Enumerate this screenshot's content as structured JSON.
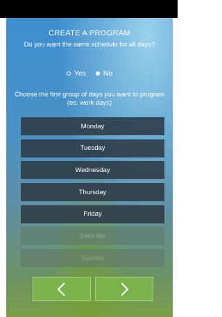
{
  "header": {
    "title": "CREATE A PROGRAM",
    "question": "Do you want the same schedule for all days?"
  },
  "schedule_choice": {
    "options": [
      {
        "label": "Yes",
        "selected": false
      },
      {
        "label": "No",
        "selected": true
      }
    ]
  },
  "instruction": "Choose the first group of days you want to program (es. work days)",
  "days": [
    {
      "label": "Monday",
      "enabled": true
    },
    {
      "label": "Tuesday",
      "enabled": true
    },
    {
      "label": "Wednesday",
      "enabled": true
    },
    {
      "label": "Thursday",
      "enabled": true
    },
    {
      "label": "Friday",
      "enabled": true
    },
    {
      "label": "Saturday",
      "enabled": false
    },
    {
      "label": "Sunday",
      "enabled": false
    }
  ],
  "navigation": {
    "prev_icon": "chevron-left-icon",
    "next_icon": "chevron-right-icon"
  },
  "colors": {
    "day_button": "#2e3a46",
    "nav_button": "#7db44b",
    "text": "#ffffff"
  }
}
